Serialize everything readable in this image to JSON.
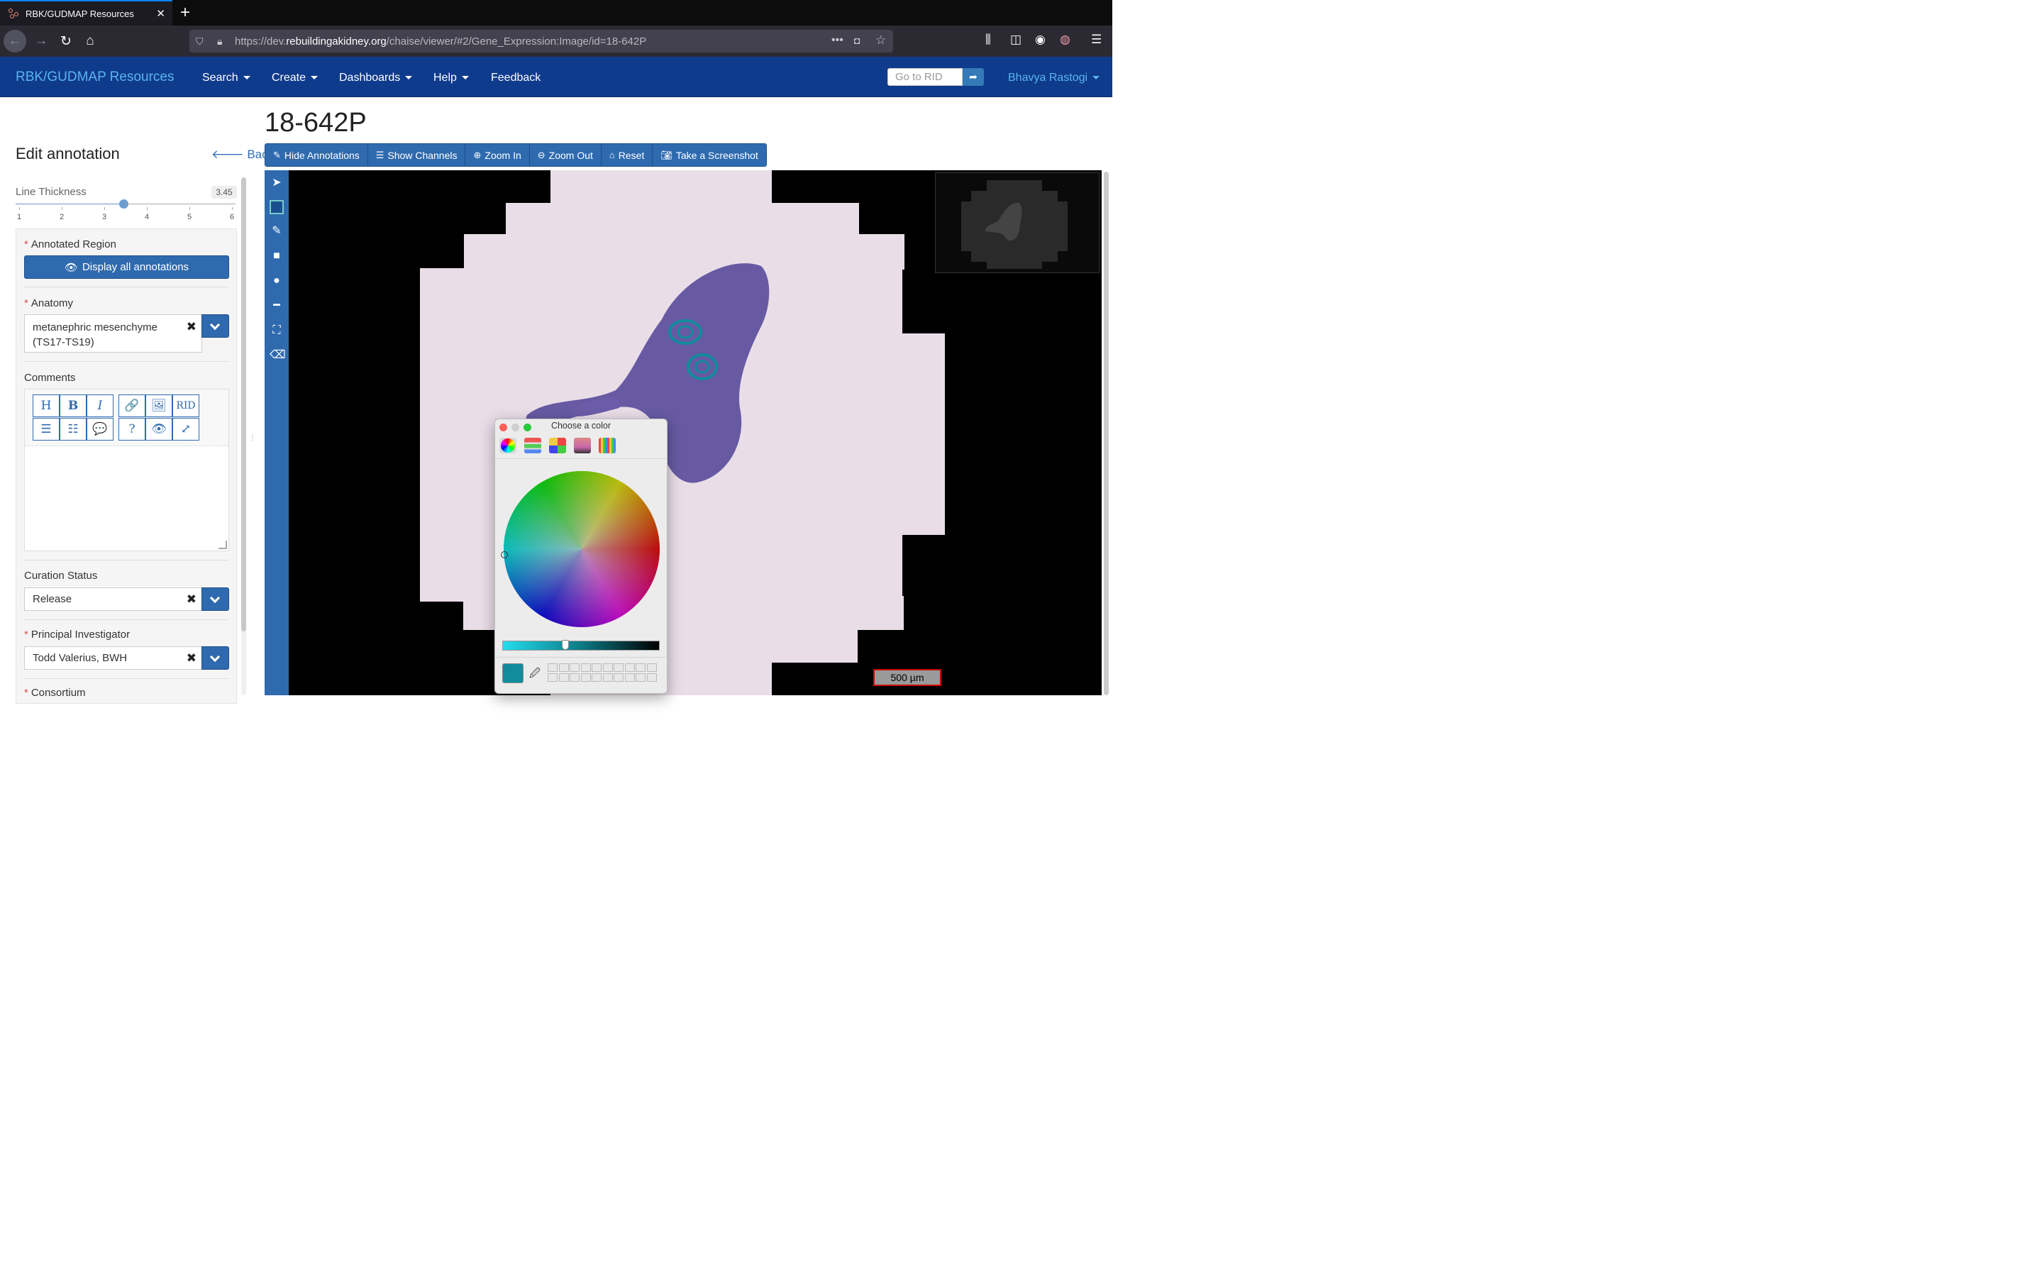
{
  "browser": {
    "tab_title": "RBK/GUDMAP Resources",
    "tab_close": "✕",
    "new_tab": "+",
    "url_prefix": "https://dev.",
    "url_host": "rebuildingakidney.org",
    "url_path": "/chaise/viewer/#2/Gene_Expression:Image/id=18-642P"
  },
  "appnav": {
    "brand": "RBK/GUDMAP Resources",
    "menus": [
      "Search",
      "Create",
      "Dashboards",
      "Help",
      "Feedback"
    ],
    "rid_placeholder": "Go to RID",
    "user": "Bhavya Rastogi"
  },
  "panel": {
    "title": "Edit annotation",
    "back": "Back",
    "line_thickness_label": "Line Thickness",
    "line_thickness_value": "3.45",
    "line_thickness_number": 3.45,
    "slider_min": 1,
    "slider_max": 6,
    "ticks": [
      "1",
      "2",
      "3",
      "4",
      "5",
      "6"
    ],
    "annotated_region_label": "Annotated Region",
    "display_all_button": "Display all annotations",
    "anatomy_label": "Anatomy",
    "anatomy_value_line1": "metanephric mesenchyme",
    "anatomy_value_line2": "(TS17-TS19)",
    "comments_label": "Comments",
    "editor_buttons_row1": [
      "H",
      "B",
      "I",
      "🔗",
      "🖼",
      "RID"
    ],
    "editor_buttons_row2": [
      "☰",
      "☷",
      "💬",
      "?",
      "👁",
      "⤢"
    ],
    "curation_label": "Curation Status",
    "curation_value": "Release",
    "pi_label": "Principal Investigator",
    "pi_value": "Todd Valerius, BWH",
    "consortium_label": "Consortium"
  },
  "viewer": {
    "title": "18-642P",
    "toolbar": [
      "Hide Annotations",
      "Show Channels",
      "Zoom In",
      "Zoom Out",
      "Reset",
      "Take a Screenshot"
    ],
    "scale_label": "500 µm"
  },
  "color_picker": {
    "title": "Choose a color",
    "selected_color": "#118c9c",
    "brightness_fraction": 0.4
  },
  "colors": {
    "brand_blue": "#0f3b8c",
    "button_blue": "#2f6aaf",
    "annotation": "#118c9c"
  }
}
